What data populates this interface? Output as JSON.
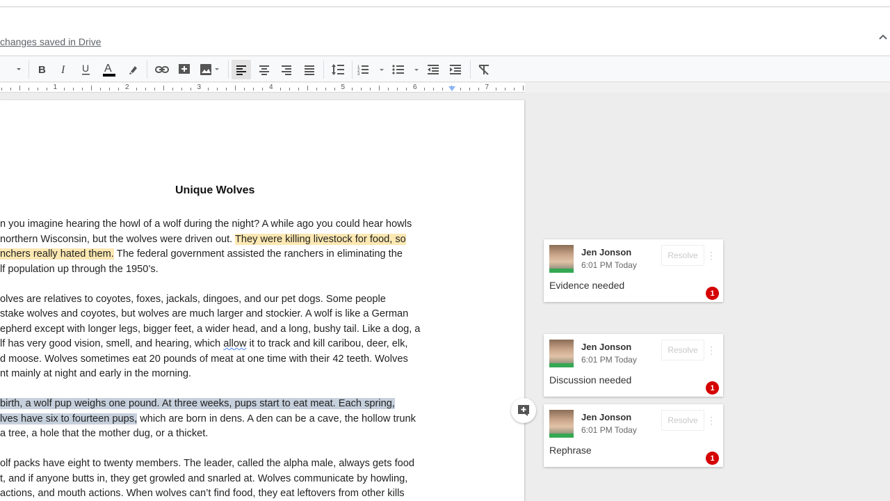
{
  "header": {
    "save_status": "changes saved in Drive"
  },
  "toolbar": {
    "items": [
      "font-size-dropdown",
      "bold",
      "italic",
      "underline",
      "text-color",
      "highlight-color",
      "insert-link",
      "add-comment",
      "insert-image",
      "align-left",
      "align-center",
      "align-right",
      "justify",
      "line-spacing",
      "numbered-list",
      "bulleted-list",
      "decrease-indent",
      "increase-indent",
      "clear-formatting"
    ],
    "active_alignment": "align-left",
    "text_color_bar": "#000000"
  },
  "ruler": {
    "numbers": [
      "1",
      "2",
      "3",
      "4",
      "5",
      "6",
      "7"
    ]
  },
  "document": {
    "title": "Unique Wolves",
    "p1": {
      "l1": "n you imagine hearing the howl of a wolf during the night? A while ago you could hear howls",
      "l2_a": "northern Wisconsin, but the wolves were driven out. ",
      "l2_b": "They were killing livestock for food, so",
      "l3_a": "nchers really hated them.",
      "l3_b": " The federal government assisted the ranchers in eliminating the",
      "l4": "lf population up through the 1950’s."
    },
    "p2": {
      "l1": "olves are relatives to coyotes, foxes, jackals, dingoes, and our pet dogs. Some people",
      "l2": "stake wolves and coyotes, but wolves are much larger and stockier. A wolf is like a German",
      "l3": "epherd except with longer legs, bigger feet, a wider head, and a long, bushy tail. Like a dog, a",
      "l4_a": "lf has very good vision, smell, and hearing, which ",
      "l4_b": "allow",
      "l4_c": " it to track and kill caribou, deer, elk,",
      "l5": "d moose. Wolves sometimes eat 20 pounds of meat at one time with their 42 teeth. Wolves",
      "l6": "nt mainly at night and early in the morning."
    },
    "p3": {
      "l1": "birth, a wolf pup weighs one pound. At three weeks, pups start to eat meat. Each spring,",
      "l2_a": "lves have six to fourteen pups,",
      "l2_b": " which are born in dens. A den can be a cave, the hollow trunk",
      "l3": "a tree, a hole that the mother dug, or a thicket."
    },
    "p4": {
      "l1": "olf packs have eight to twenty members. The leader, called the alpha male, always gets food",
      "l2": "t, and if anyone butts in, they get growled and snarled at. Wolves communicate by howling,",
      "l3": " actions, and mouth actions. When wolves can’t find food, they eat leftovers from other kills"
    },
    "highlight_yellow": "#fce8b2",
    "highlight_gray": "#c6d0dc"
  },
  "comments": [
    {
      "author": "Jen Jonson",
      "time": "6:01 PM Today",
      "resolve_label": "Resolve",
      "text": "Evidence needed",
      "badge": "1"
    },
    {
      "author": "Jen Jonson",
      "time": "6:01 PM Today",
      "resolve_label": "Resolve",
      "text": "Discussion needed",
      "badge": "1"
    },
    {
      "author": "Jen Jonson",
      "time": "6:01 PM Today",
      "resolve_label": "Resolve",
      "text": "Rephrase",
      "badge": "1"
    }
  ]
}
